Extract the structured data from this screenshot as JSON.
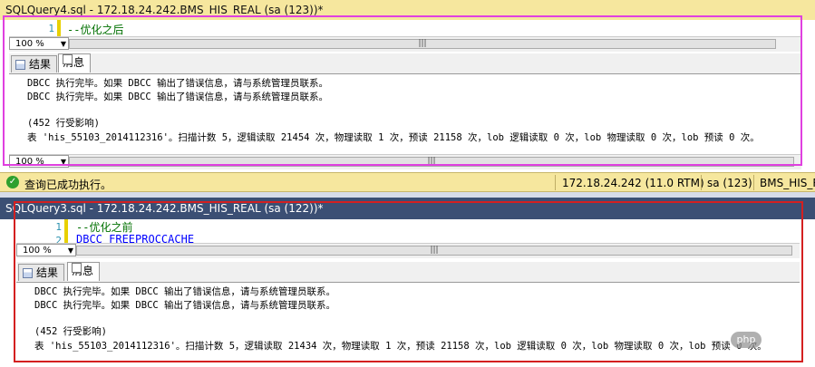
{
  "top_window": {
    "title": "SQLQuery4.sql - 172.18.24.242.BMS_HIS_REAL (sa (123))*",
    "code_lines": [
      {
        "num": "1",
        "text": "--优化之后"
      }
    ],
    "zoom": "100 %",
    "tabs": [
      "结果",
      "消息"
    ],
    "messages": [
      "DBCC 执行完毕。如果 DBCC 输出了错误信息，请与系统管理员联系。",
      "DBCC 执行完毕。如果 DBCC 输出了错误信息，请与系统管理员联系。",
      "(452 行受影响)",
      "表 'his_55103_2014112316'。扫描计数 5，逻辑读取 21454 次，物理读取 1 次，预读 21158 次，lob 逻辑读取 0 次，lob 物理读取 0 次，lob 预读 0 次。"
    ],
    "zoom_bottom": "100 %",
    "frame_color": "#e040e0"
  },
  "status_bar": {
    "message": "查询已成功执行。",
    "server": "172.18.24.242 (11.0 RTM)",
    "user": "sa (123)",
    "database": "BMS_HIS_R"
  },
  "bottom_window": {
    "title": "SQLQuery3.sql - 172.18.24.242.BMS_HIS_REAL (sa (122))*",
    "code_lines": [
      {
        "num": "1",
        "text": "--优化之前"
      },
      {
        "num": "2",
        "text": "DBCC FREEPROCCACHE"
      }
    ],
    "zoom": "100 %",
    "tabs": [
      "结果",
      "消息"
    ],
    "messages": [
      "DBCC 执行完毕。如果 DBCC 输出了错误信息，请与系统管理员联系。",
      "DBCC 执行完毕。如果 DBCC 输出了错误信息，请与系统管理员联系。",
      "(452 行受影响)",
      "表 'his_55103_2014112316'。扫描计数 5，逻辑读取 21434 次，物理读取 1 次，预读 21158 次，lob 逻辑读取 0 次，lob 物理读取 0 次，lob 预读 0 次。"
    ],
    "frame_color": "#d42020"
  },
  "watermark": {
    "logo": "php",
    "text": "中文网"
  },
  "icons": {
    "zoom_dropdown": "chevron-down-icon",
    "status_ok": "checkmark-icon",
    "scroll_thumb": "grip-icon"
  }
}
